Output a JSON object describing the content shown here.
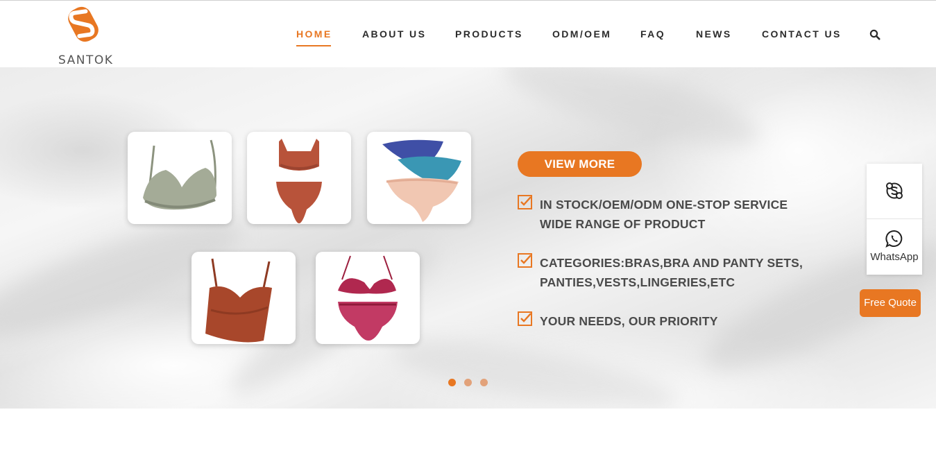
{
  "brand": {
    "name": "SANTOK",
    "accent_color": "#e87722"
  },
  "nav": {
    "items": [
      {
        "label": "HOME",
        "active": true
      },
      {
        "label": "ABOUT US",
        "active": false
      },
      {
        "label": "PRODUCTS",
        "active": false
      },
      {
        "label": "ODM/OEM",
        "active": false
      },
      {
        "label": "FAQ",
        "active": false
      },
      {
        "label": "NEWS",
        "active": false
      },
      {
        "label": "CONTACT US",
        "active": false
      }
    ],
    "search_icon": "search-icon"
  },
  "hero": {
    "products": [
      {
        "name": "bra-sage-icon"
      },
      {
        "name": "bra-panty-set-rust-icon"
      },
      {
        "name": "lace-panties-stack-icon"
      },
      {
        "name": "cami-top-rust-icon"
      },
      {
        "name": "lace-lingerie-set-icon"
      }
    ],
    "view_more_label": "VIEW MORE",
    "bullets": [
      {
        "lines": [
          "IN STOCK/OEM/ODM ONE-STOP SERVICE",
          "WIDE RANGE OF PRODUCT"
        ]
      },
      {
        "lines": [
          "CATEGORIES:BRAS,BRA AND PANTY SETS,",
          "PANTIES,VESTS,LINGERIES,ETC"
        ]
      },
      {
        "lines": [
          "YOUR NEEDS, OUR PRIORITY"
        ]
      }
    ],
    "slider_dots": [
      {
        "active": true
      },
      {
        "active": false
      },
      {
        "active": false
      }
    ]
  },
  "side_widget": {
    "skype_icon": "skype-icon",
    "whatsapp_label": "WhatsApp",
    "whatsapp_icon": "whatsapp-icon",
    "free_quote_label": "Free Quote"
  }
}
